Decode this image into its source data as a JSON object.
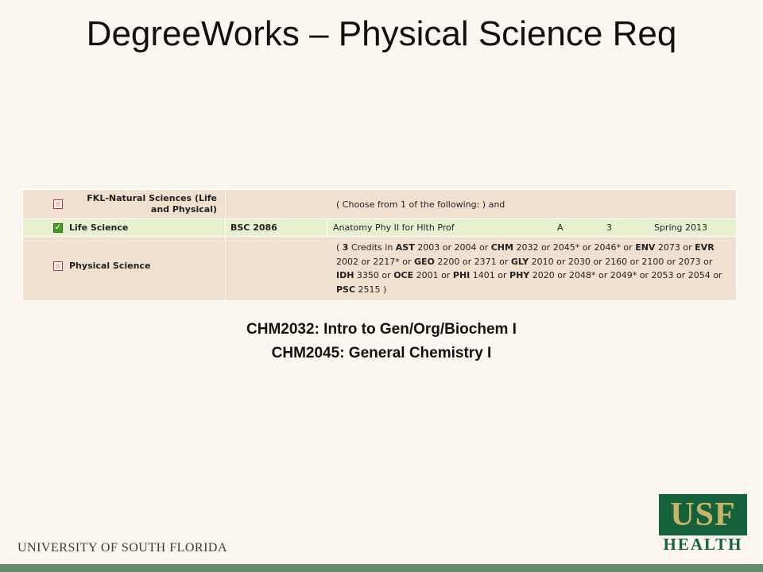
{
  "title": "DegreeWorks – Physical Science Req",
  "audit": {
    "header": {
      "label": "FKL-Natural Sciences (Life and Physical)",
      "checked": false,
      "description": "( Choose from 1 of the following: ) and"
    },
    "life": {
      "label": "Life Science",
      "checked": true,
      "code": "BSC 2086",
      "course_title": "Anatomy Phy II for Hlth Prof",
      "grade": "A",
      "credits": "3",
      "term": "Spring 2013"
    },
    "physical": {
      "label": "Physical Science",
      "checked": false,
      "requirement_html": "( <b>3</b> Credits in <b>AST</b> 2003 or 2004 or <b>CHM</b> 2032 or 2045* or 2046* or <b>ENV</b> 2073 or <b>EVR</b> 2002 or 2217* or <b>GEO</b> 2200 or 2371 or <b>GLY</b> 2010 or 2030 or 2160 or 2100 or 2073 or <b>IDH</b> 3350 or <b>OCE</b> 2001 or <b>PHI</b> 1401 or <b>PHY</b> 2020 or 2048* or 2049* or 2053 or 2054 or <b>PSC</b> 2515 )"
    }
  },
  "captions": [
    "CHM2032: Intro to Gen/Org/Biochem I",
    "CHM2045: General Chemistry I"
  ],
  "footer": {
    "university": "UNIVERSITY OF SOUTH FLORIDA",
    "logo_top": "USF",
    "logo_reg": "®",
    "logo_bottom": "HEALTH"
  },
  "colors": {
    "accent_green": "#63896e",
    "logo_green": "#15613b",
    "logo_gold": "#c9b466"
  }
}
